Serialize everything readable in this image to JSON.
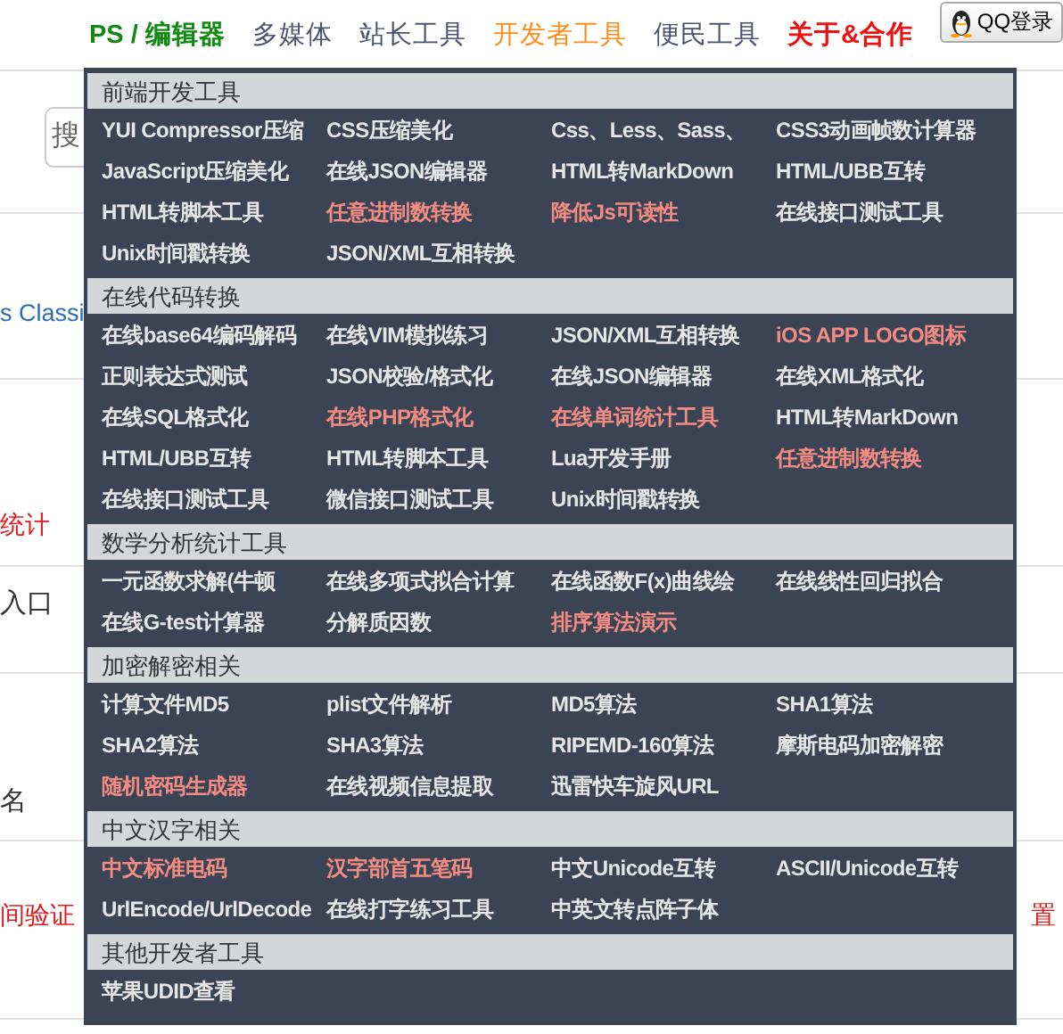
{
  "nav": {
    "items": [
      {
        "label": "PS / 编辑器",
        "color": "#118a11",
        "bold": true
      },
      {
        "label": "多媒体",
        "color": "#4a5470",
        "bold": false
      },
      {
        "label": "站长工具",
        "color": "#4a5470",
        "bold": false
      },
      {
        "label": "开发者工具",
        "color": "#ff8c1a",
        "bold": false
      },
      {
        "label": "便民工具",
        "color": "#4a5470",
        "bold": false
      },
      {
        "label": "关于&合作",
        "color": "#ee1111",
        "bold": true
      }
    ],
    "login_button": "QQ登录"
  },
  "background": {
    "search": {
      "placeholder": "搜"
    },
    "rows": [
      {
        "text": "s Classi",
        "kind": "link"
      },
      {
        "text": "统计",
        "kind": "red"
      },
      {
        "text": "入口",
        "kind": "plain"
      },
      {
        "text": "名",
        "kind": "plain"
      },
      {
        "text": "间验证",
        "kind": "red",
        "right_text": "置"
      }
    ]
  },
  "menu": {
    "sections": [
      {
        "title": "前端开发工具",
        "items": [
          {
            "label": "YUI Compressor压缩",
            "highlighted": false
          },
          {
            "label": "CSS压缩美化",
            "highlighted": false
          },
          {
            "label": "Css、Less、Sass、",
            "highlighted": false
          },
          {
            "label": "CSS3动画帧数计算器",
            "highlighted": false
          },
          {
            "label": "JavaScript压缩美化",
            "highlighted": false
          },
          {
            "label": "在线JSON编辑器",
            "highlighted": false
          },
          {
            "label": "HTML转MarkDown",
            "highlighted": false
          },
          {
            "label": "HTML/UBB互转",
            "highlighted": false
          },
          {
            "label": "HTML转脚本工具",
            "highlighted": false
          },
          {
            "label": "任意进制数转换",
            "highlighted": true
          },
          {
            "label": "降低Js可读性",
            "highlighted": true
          },
          {
            "label": "在线接口测试工具",
            "highlighted": false
          },
          {
            "label": "Unix时间戳转换",
            "highlighted": false
          },
          {
            "label": "JSON/XML互相转换",
            "highlighted": false
          }
        ]
      },
      {
        "title": "在线代码转换",
        "items": [
          {
            "label": "在线base64编码解码",
            "highlighted": false
          },
          {
            "label": "在线VIM模拟练习",
            "highlighted": false
          },
          {
            "label": "JSON/XML互相转换",
            "highlighted": false
          },
          {
            "label": "iOS APP LOGO图标",
            "highlighted": true
          },
          {
            "label": "正则表达式测试",
            "highlighted": false
          },
          {
            "label": "JSON校验/格式化",
            "highlighted": false
          },
          {
            "label": "在线JSON编辑器",
            "highlighted": false
          },
          {
            "label": "在线XML格式化",
            "highlighted": false
          },
          {
            "label": "在线SQL格式化",
            "highlighted": false
          },
          {
            "label": "在线PHP格式化",
            "highlighted": true
          },
          {
            "label": "在线单词统计工具",
            "highlighted": true
          },
          {
            "label": "HTML转MarkDown",
            "highlighted": false
          },
          {
            "label": "HTML/UBB互转",
            "highlighted": false
          },
          {
            "label": "HTML转脚本工具",
            "highlighted": false
          },
          {
            "label": "Lua开发手册",
            "highlighted": false
          },
          {
            "label": "任意进制数转换",
            "highlighted": true
          },
          {
            "label": "在线接口测试工具",
            "highlighted": false
          },
          {
            "label": "微信接口测试工具",
            "highlighted": false
          },
          {
            "label": "Unix时间戳转换",
            "highlighted": false
          }
        ]
      },
      {
        "title": "数学分析统计工具",
        "items": [
          {
            "label": "一元函数求解(牛顿",
            "highlighted": false
          },
          {
            "label": "在线多项式拟合计算",
            "highlighted": false
          },
          {
            "label": "在线函数F(x)曲线绘",
            "highlighted": false
          },
          {
            "label": "在线线性回归拟合",
            "highlighted": false
          },
          {
            "label": "在线G-test计算器",
            "highlighted": false
          },
          {
            "label": "分解质因数",
            "highlighted": false
          },
          {
            "label": "排序算法演示",
            "highlighted": true
          }
        ]
      },
      {
        "title": "加密解密相关",
        "items": [
          {
            "label": "计算文件MD5",
            "highlighted": false
          },
          {
            "label": "plist文件解析",
            "highlighted": false
          },
          {
            "label": "MD5算法",
            "highlighted": false
          },
          {
            "label": "SHA1算法",
            "highlighted": false
          },
          {
            "label": "SHA2算法",
            "highlighted": false
          },
          {
            "label": "SHA3算法",
            "highlighted": false
          },
          {
            "label": "RIPEMD-160算法",
            "highlighted": false
          },
          {
            "label": "摩斯电码加密解密",
            "highlighted": false
          },
          {
            "label": "随机密码生成器",
            "highlighted": true
          },
          {
            "label": "在线视频信息提取",
            "highlighted": false
          },
          {
            "label": "迅雷快车旋风URL",
            "highlighted": false
          }
        ]
      },
      {
        "title": "中文汉字相关",
        "items": [
          {
            "label": "中文标准电码",
            "highlighted": true
          },
          {
            "label": "汉字部首五笔码",
            "highlighted": true
          },
          {
            "label": "中文Unicode互转",
            "highlighted": false
          },
          {
            "label": "ASCII/Unicode互转",
            "highlighted": false
          },
          {
            "label": "UrlEncode/UrlDecode",
            "highlighted": false
          },
          {
            "label": "在线打字练习工具",
            "highlighted": false
          },
          {
            "label": "中英文转点阵子体",
            "highlighted": false
          }
        ]
      },
      {
        "title": "其他开发者工具",
        "items": [
          {
            "label": "苹果UDID查看",
            "highlighted": false
          }
        ]
      }
    ]
  }
}
